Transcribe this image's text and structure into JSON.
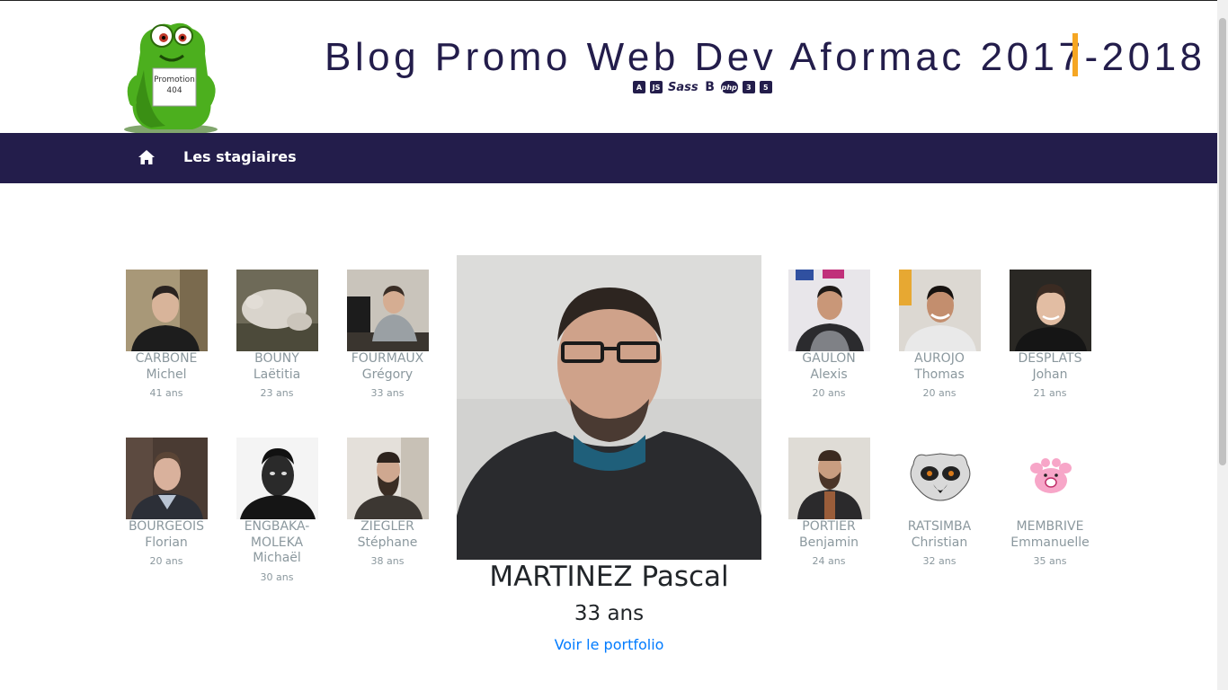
{
  "header": {
    "title": "Blog Promo Web Dev Aformac 2017-2018",
    "mascot_badge_line1": "Promotion",
    "mascot_badge_line2": "404",
    "tech_icons": [
      "angular-icon",
      "js-icon",
      "sass-icon",
      "bootstrap-icon",
      "php-icon",
      "css3-icon",
      "html5-icon"
    ],
    "tech_icon_labels": [
      "A",
      "JS",
      "Sass",
      "B",
      "php",
      "3",
      "5"
    ]
  },
  "nav": {
    "home_icon": "home-icon",
    "items": [
      {
        "label": "Les stagiaires"
      }
    ]
  },
  "students": [
    {
      "lastname": "CARBONE",
      "firstname": "Michel",
      "age": "41 ans"
    },
    {
      "lastname": "BOUNY",
      "firstname": "Laëtitia",
      "age": "23 ans"
    },
    {
      "lastname": "FOURMAUX",
      "firstname": "Grégory",
      "age": "33 ans"
    },
    {
      "lastname": "GAULON",
      "firstname": "Alexis",
      "age": "20 ans"
    },
    {
      "lastname": "AUROJO",
      "firstname": "Thomas",
      "age": "20 ans"
    },
    {
      "lastname": "DESPLATS",
      "firstname": "Johan",
      "age": "21 ans"
    },
    {
      "lastname": "BOURGEOIS",
      "firstname": "Florian",
      "age": "20 ans"
    },
    {
      "lastname": "ENGBAKA-MOLEKA",
      "firstname": "Michaël",
      "age": "30 ans"
    },
    {
      "lastname": "ZIEGLER",
      "firstname": "Stéphane",
      "age": "38 ans"
    },
    {
      "lastname": "PORTIER",
      "firstname": "Benjamin",
      "age": "24 ans"
    },
    {
      "lastname": "RATSIMBA",
      "firstname": "Christian",
      "age": "32 ans"
    },
    {
      "lastname": "MEMBRIVE",
      "firstname": "Emmanuelle",
      "age": "35 ans"
    }
  ],
  "featured": {
    "name": "MARTINEZ Pascal",
    "age": "33 ans",
    "link_label": "Voir le portfolio"
  },
  "colors": {
    "navbar": "#231d4b",
    "title": "#231d4b",
    "accent_bar": "#f5a623",
    "student_text": "#8b989e",
    "link": "#007bff"
  }
}
